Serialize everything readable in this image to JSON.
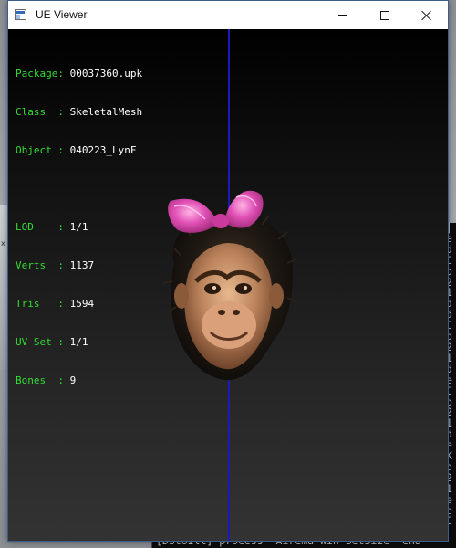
{
  "window": {
    "title": "UE Viewer",
    "controls": {
      "minimize_icon": "minimize-icon",
      "maximize_icon": "maximize-icon",
      "close_icon": "close-icon"
    }
  },
  "info": {
    "rows_group1": [
      {
        "key": "Package:",
        "value": "00037360.upk"
      },
      {
        "key": "Class  :",
        "value": "SkeletalMesh"
      },
      {
        "key": "Object :",
        "value": "040223_LynF"
      }
    ],
    "rows_group2": [
      {
        "key": "LOD    :",
        "value": "1/1"
      },
      {
        "key": "Verts  :",
        "value": "1137"
      },
      {
        "key": "Tris   :",
        "value": "1594"
      },
      {
        "key": "UV Set :",
        "value": "1/1"
      },
      {
        "key": "Bones  :",
        "value": "9"
      }
    ]
  },
  "terminal": {
    "right_edge_chars": [
      "|",
      "e",
      "d",
      "C",
      "o",
      "2",
      "1",
      "d",
      "d",
      "C",
      "o",
      "2",
      "1",
      "d",
      "e",
      "C",
      "o",
      "2",
      "1",
      "d",
      "e",
      "K",
      "o",
      "2",
      "1",
      "e",
      "e",
      "C"
    ],
    "bottom_line": "[DStoIll] process  Airema Win SetSize  ena"
  },
  "colors": {
    "label_green": "#33dd33",
    "axis_blue": "#1a1ab4",
    "viewport_top": "#000000",
    "viewport_bottom": "#333333",
    "bow_pink": "#e04fb4"
  },
  "model": {
    "icon": "monkey-head-mesh"
  }
}
